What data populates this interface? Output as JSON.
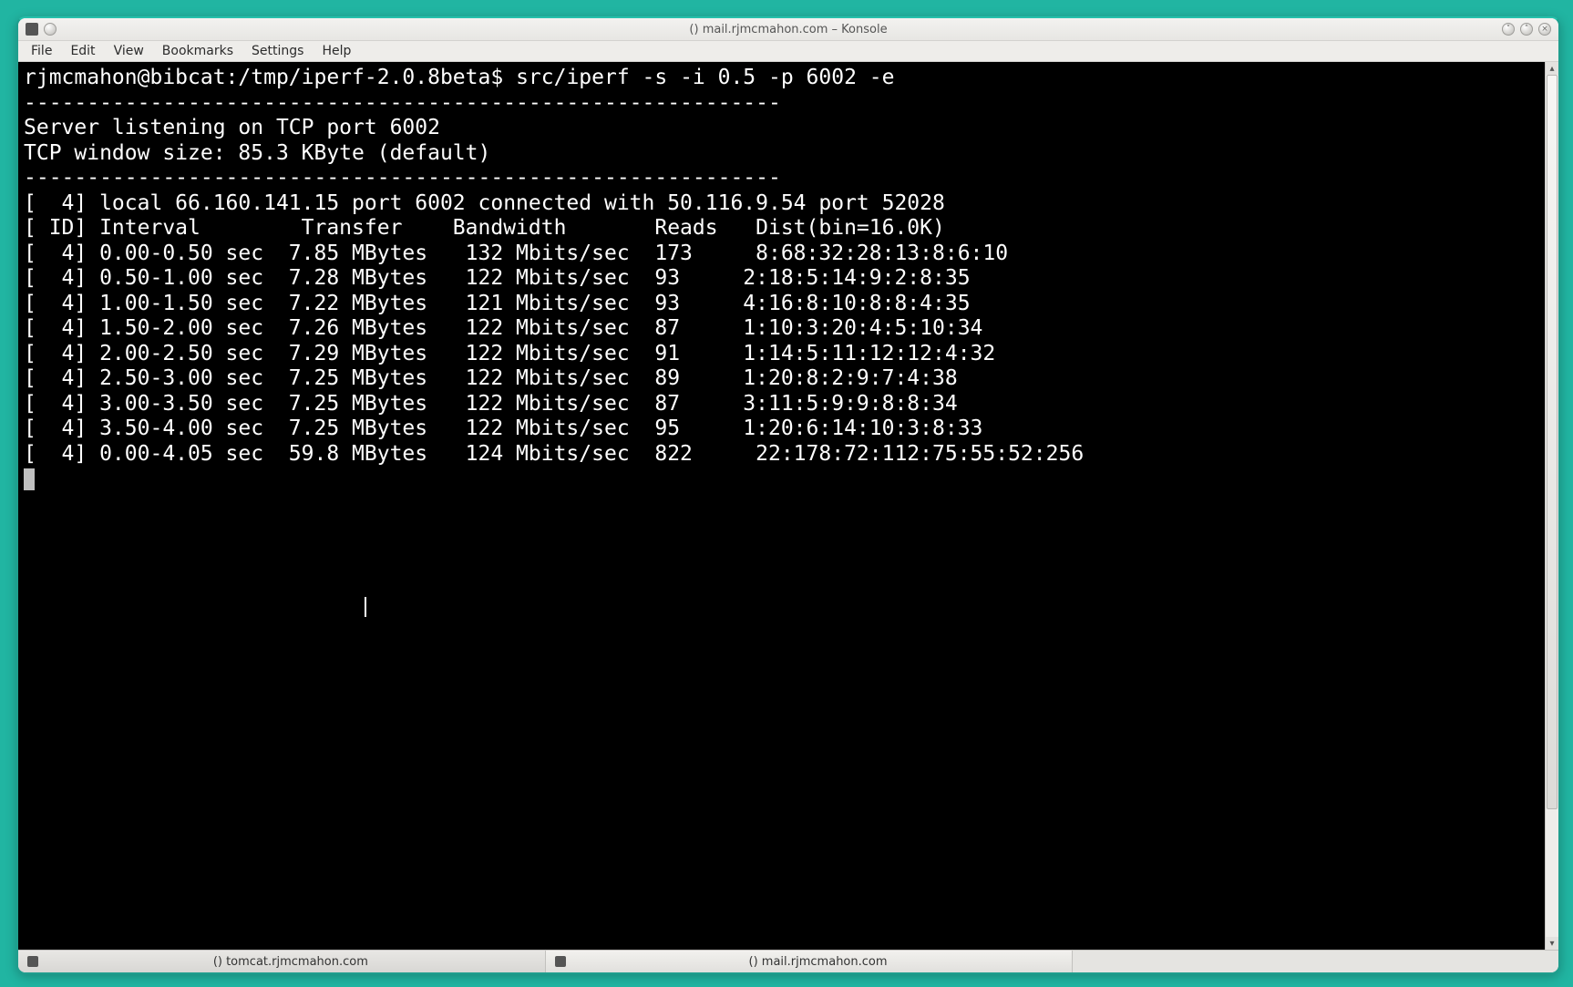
{
  "window": {
    "title": "() mail.rjmcmahon.com – Konsole"
  },
  "menubar": {
    "items": [
      "File",
      "Edit",
      "View",
      "Bookmarks",
      "Settings",
      "Help"
    ]
  },
  "terminal": {
    "prompt": "rjmcmahon@bibcat:/tmp/iperf-2.0.8beta$",
    "command": "src/iperf -s -i 0.5 -p 6002 -e",
    "divider": "------------------------------------------------------------",
    "header1": "Server listening on TCP port 6002",
    "header2": "TCP window size: 85.3 KByte (default)",
    "conn_line": "[  4] local 66.160.141.15 port 6002 connected with 50.116.9.54 port 52028",
    "col_line": "[ ID] Interval        Transfer    Bandwidth       Reads   Dist(bin=16.0K)",
    "rows": [
      "[  4] 0.00-0.50 sec  7.85 MBytes   132 Mbits/sec  173     8:68:32:28:13:8:6:10",
      "[  4] 0.50-1.00 sec  7.28 MBytes   122 Mbits/sec  93     2:18:5:14:9:2:8:35",
      "[  4] 1.00-1.50 sec  7.22 MBytes   121 Mbits/sec  93     4:16:8:10:8:8:4:35",
      "[  4] 1.50-2.00 sec  7.26 MBytes   122 Mbits/sec  87     1:10:3:20:4:5:10:34",
      "[  4] 2.00-2.50 sec  7.29 MBytes   122 Mbits/sec  91     1:14:5:11:12:12:4:32",
      "[  4] 2.50-3.00 sec  7.25 MBytes   122 Mbits/sec  89     1:20:8:2:9:7:4:38",
      "[  4] 3.00-3.50 sec  7.25 MBytes   122 Mbits/sec  87     3:11:5:9:9:8:8:34",
      "[  4] 3.50-4.00 sec  7.25 MBytes   122 Mbits/sec  95     1:20:6:14:10:3:8:33",
      "[  4] 0.00-4.05 sec  59.8 MBytes   124 Mbits/sec  822     22:178:72:112:75:55:52:256"
    ]
  },
  "tabs": [
    {
      "label": "() tomcat.rjmcmahon.com",
      "active": false
    },
    {
      "label": "() mail.rjmcmahon.com",
      "active": true
    }
  ],
  "colors": {
    "desktop": "#21b5a2",
    "term_bg": "#000000",
    "term_fg": "#ffffff"
  }
}
